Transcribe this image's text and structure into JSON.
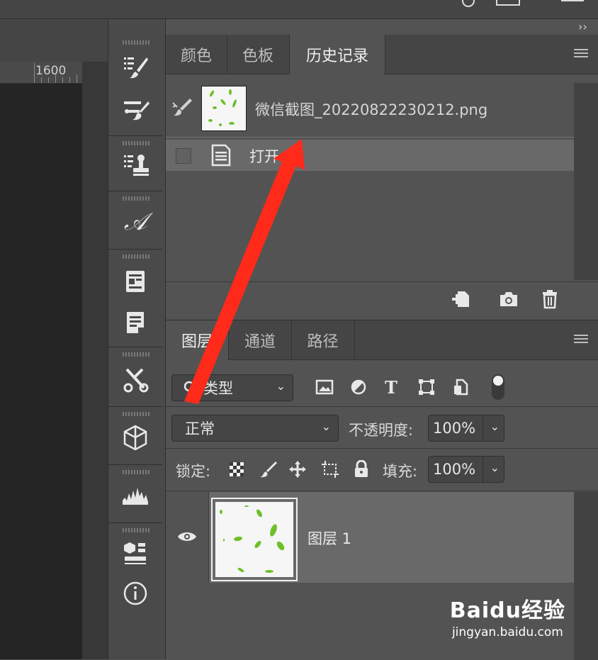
{
  "collapse_left": "‹‹",
  "collapse_right": "››",
  "ruler": {
    "label": "1600"
  },
  "history_panel": {
    "tabs": [
      {
        "label": "颜色",
        "active": false
      },
      {
        "label": "色板",
        "active": false
      },
      {
        "label": "历史记录",
        "active": true
      }
    ],
    "snapshot_label": "微信截图_20220822230212.png",
    "steps": [
      {
        "label": "打开",
        "selected": true
      }
    ]
  },
  "layers_panel": {
    "tabs": [
      {
        "label": "图层",
        "active": true
      },
      {
        "label": "通道",
        "active": false
      },
      {
        "label": "路径",
        "active": false
      }
    ],
    "filter_type": "类型",
    "blend_mode": "正常",
    "opacity_label": "不透明度:",
    "opacity_value": "100%",
    "lock_label": "锁定:",
    "fill_label": "填充:",
    "fill_value": "100%",
    "layers": [
      {
        "name": "图层 1",
        "visible": true
      }
    ]
  },
  "watermark": {
    "brand": "Baidu经验",
    "url": "jingyan.baidu.com"
  },
  "colors": {
    "panel_bg": "#535353",
    "dark_bg": "#282828",
    "tab_bg": "#454545",
    "arrow": "#ff2a1a",
    "leaf_green": "#6fbf2a"
  }
}
